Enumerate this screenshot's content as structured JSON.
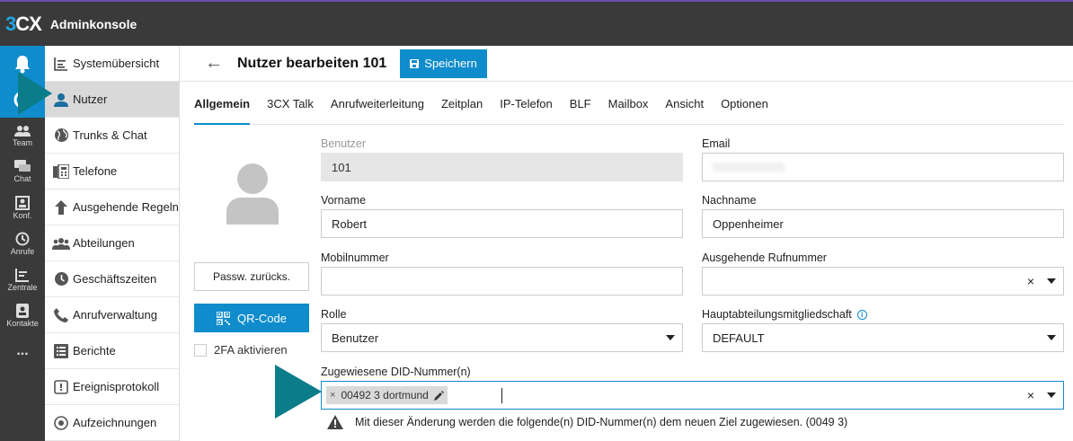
{
  "app": {
    "logo_three": "3",
    "logo_cx": "CX",
    "title": "Adminkonsole"
  },
  "rail": {
    "items": [
      {
        "label": "Team",
        "icon": "team-icon"
      },
      {
        "label": "Chat",
        "icon": "chat-icon"
      },
      {
        "label": "Konf.",
        "icon": "conference-icon"
      },
      {
        "label": "Anrufe",
        "icon": "history-icon"
      },
      {
        "label": "Zentrale",
        "icon": "switchboard-icon"
      },
      {
        "label": "Kontakte",
        "icon": "contacts-icon"
      }
    ],
    "more": "..."
  },
  "menu": {
    "items": [
      {
        "label": "Systemübersicht",
        "icon": "dashboard-icon"
      },
      {
        "label": "Nutzer",
        "icon": "user-icon",
        "active": true
      },
      {
        "label": "Trunks & Chat",
        "icon": "globe-icon"
      },
      {
        "label": "Telefone",
        "icon": "phones-icon"
      },
      {
        "label": "Ausgehende Regeln",
        "icon": "arrow-up-icon"
      },
      {
        "label": "Abteilungen",
        "icon": "group-icon"
      },
      {
        "label": "Geschäftszeiten",
        "icon": "clock-icon"
      },
      {
        "label": "Anrufverwaltung",
        "icon": "phone-icon"
      },
      {
        "label": "Berichte",
        "icon": "report-icon"
      },
      {
        "label": "Ereignisprotokoll",
        "icon": "log-icon"
      },
      {
        "label": "Aufzeichnungen",
        "icon": "record-icon"
      }
    ]
  },
  "header": {
    "back": "←",
    "title": "Nutzer bearbeiten 101",
    "save_label": "Speichern"
  },
  "tabs": [
    "Allgemein",
    "3CX Talk",
    "Anrufweiterleitung",
    "Zeitplan",
    "IP-Telefon",
    "BLF",
    "Mailbox",
    "Ansicht",
    "Optionen"
  ],
  "left_panel": {
    "password_reset": "Passw. zurücks.",
    "qr_code": "QR-Code",
    "twofa": "2FA aktivieren"
  },
  "form": {
    "benutzer_label": "Benutzer",
    "benutzer_value": "101",
    "email_label": "Email",
    "vorname_label": "Vorname",
    "vorname_value": "Robert",
    "nachname_label": "Nachname",
    "nachname_value": "Oppenheimer",
    "mobil_label": "Mobilnummer",
    "ausgehend_label": "Ausgehende Rufnummer",
    "rolle_label": "Rolle",
    "rolle_value": "Benutzer",
    "haupt_label": "Hauptabteilungsmitgliedschaft",
    "haupt_value": "DEFAULT",
    "did_label": "Zugewiesene DID-Nummer(n)",
    "did_chip": "00492            3 dortmund",
    "clear": "×"
  },
  "warning": {
    "text": "Mit dieser Änderung werden die folgende(n) DID-Nummer(n) dem neuen Ziel zugewiesen. (0049                  3)"
  },
  "colors": {
    "accent": "#0f8ccc",
    "topbar": "#3a3a3a",
    "arrow": "#0b7c8a"
  }
}
